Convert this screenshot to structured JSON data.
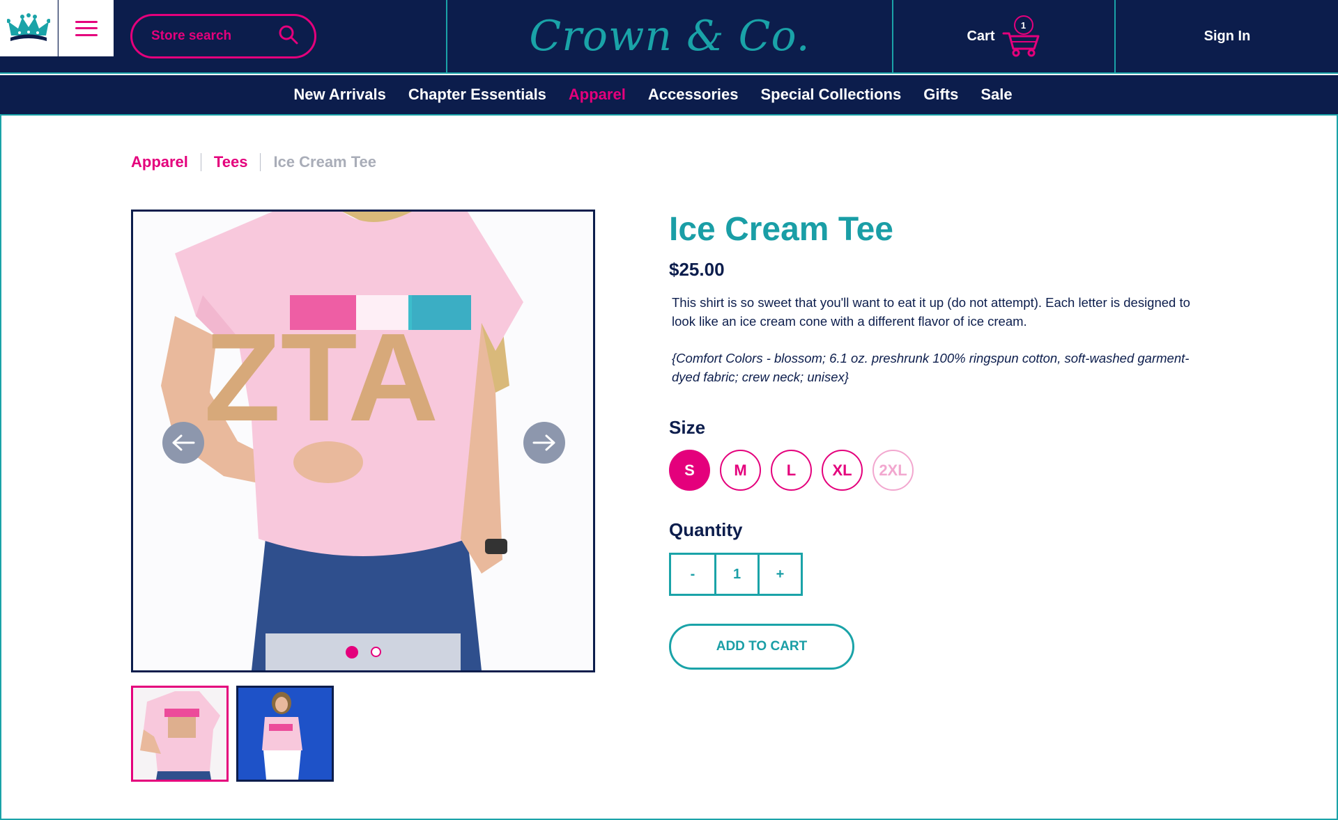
{
  "header": {
    "search_label": "Store search",
    "brand": "Crown & Co.",
    "cart_label": "Cart",
    "cart_count": "1",
    "signin_label": "Sign In"
  },
  "nav": {
    "items": [
      "New Arrivals",
      "Chapter Essentials",
      "Apparel",
      "Accessories",
      "Special Collections",
      "Gifts",
      "Sale"
    ],
    "active": "Apparel"
  },
  "breadcrumb": [
    "Apparel",
    "Tees",
    "Ice Cream Tee"
  ],
  "product": {
    "title": "Ice Cream Tee",
    "price": "$25.00",
    "description": "This shirt is so sweet that you'll want to eat it up (do not attempt). Each letter is designed to look like an ice cream cone with a different flavor of ice cream.",
    "specs": "{Comfort Colors - blossom; 6.1 oz. preshrunk 100% ringspun cotton, soft-washed garment-dyed fabric; crew neck; unisex}",
    "size_label": "Size",
    "sizes": [
      {
        "label": "S",
        "state": "selected"
      },
      {
        "label": "M",
        "state": "available"
      },
      {
        "label": "L",
        "state": "available"
      },
      {
        "label": "XL",
        "state": "available"
      },
      {
        "label": "2XL",
        "state": "unavailable"
      }
    ],
    "quantity_label": "Quantity",
    "quantity": {
      "minus": "-",
      "value": "1",
      "plus": "+"
    },
    "add_to_cart": "ADD TO CART"
  },
  "gallery": {
    "shirt_letters": "ZTA",
    "slide_count": 2,
    "active_slide": 1,
    "thumbnail_count": 2
  },
  "colors": {
    "navy": "#0c1d4c",
    "teal": "#1aa3a8",
    "pink": "#e4007c",
    "shirt_pink": "#f8c8dc",
    "thumb_blue_bg": "#1e52c8"
  },
  "icons": [
    "crown-logo-icon",
    "hamburger-menu-icon",
    "search-icon",
    "cart-icon",
    "arrow-left-icon",
    "arrow-right-icon"
  ]
}
